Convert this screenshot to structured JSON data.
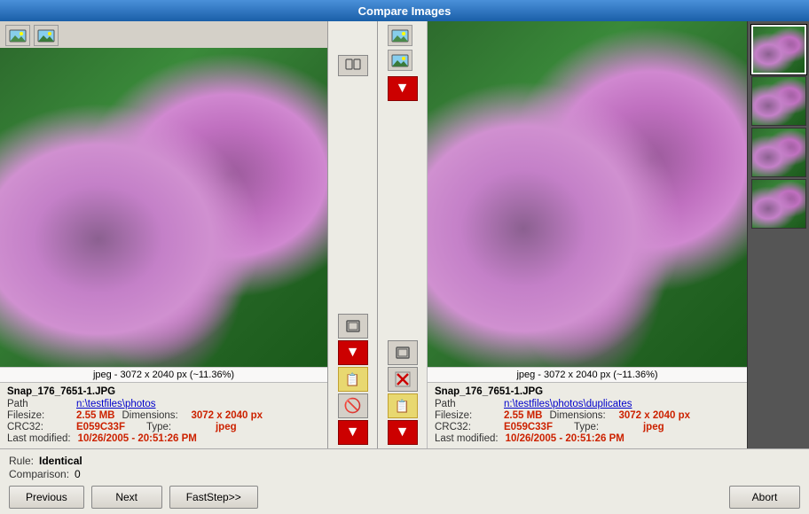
{
  "window": {
    "title": "Compare Images"
  },
  "left": {
    "header_btn1_icon": "🖼",
    "image_info": "jpeg - 3072 x 2040 px (~11.36%)",
    "filename": "Snap_176_7651-1.JPG",
    "path_label": "Path",
    "path_value": "n:\\testfiles\\photos",
    "filesize_label": "Filesize:",
    "filesize_value": "2.55 MB",
    "dimensions_label": "Dimensions:",
    "dimensions_value": "3072 x 2040 px",
    "crc32_label": "CRC32:",
    "crc32_value": "E059C33F",
    "type_label": "Type:",
    "type_value": "jpeg",
    "lastmod_label": "Last modified:",
    "lastmod_value": "10/26/2005 - 20:51:26 PM"
  },
  "right": {
    "image_info": "jpeg - 3072 x 2040 px (~11.36%)",
    "filename": "Snap_176_7651-1.JPG",
    "path_label": "Path",
    "path_value": "n:\\testfiles\\photos\\duplicates",
    "filesize_label": "Filesize:",
    "filesize_value": "2.55 MB",
    "dimensions_label": "Dimensions:",
    "dimensions_value": "3072 x 2040 px",
    "crc32_label": "CRC32:",
    "crc32_value": "E059C33F",
    "type_label": "Type:",
    "type_value": "jpeg",
    "lastmod_label": "Last modified:",
    "lastmod_value": "10/26/2005 - 20:51:26 PM"
  },
  "bottom": {
    "rule_label": "Rule:",
    "rule_value": "Identical",
    "comparison_label": "Comparison:",
    "comparison_value": "0",
    "prev_label": "Previous",
    "next_label": "Next",
    "faststep_label": "FastStep>>",
    "abort_label": "Abort"
  },
  "thumbnails": [
    {
      "id": "thumb-1",
      "selected": true
    },
    {
      "id": "thumb-2",
      "selected": false
    },
    {
      "id": "thumb-3",
      "selected": false
    },
    {
      "id": "thumb-4",
      "selected": false
    }
  ]
}
